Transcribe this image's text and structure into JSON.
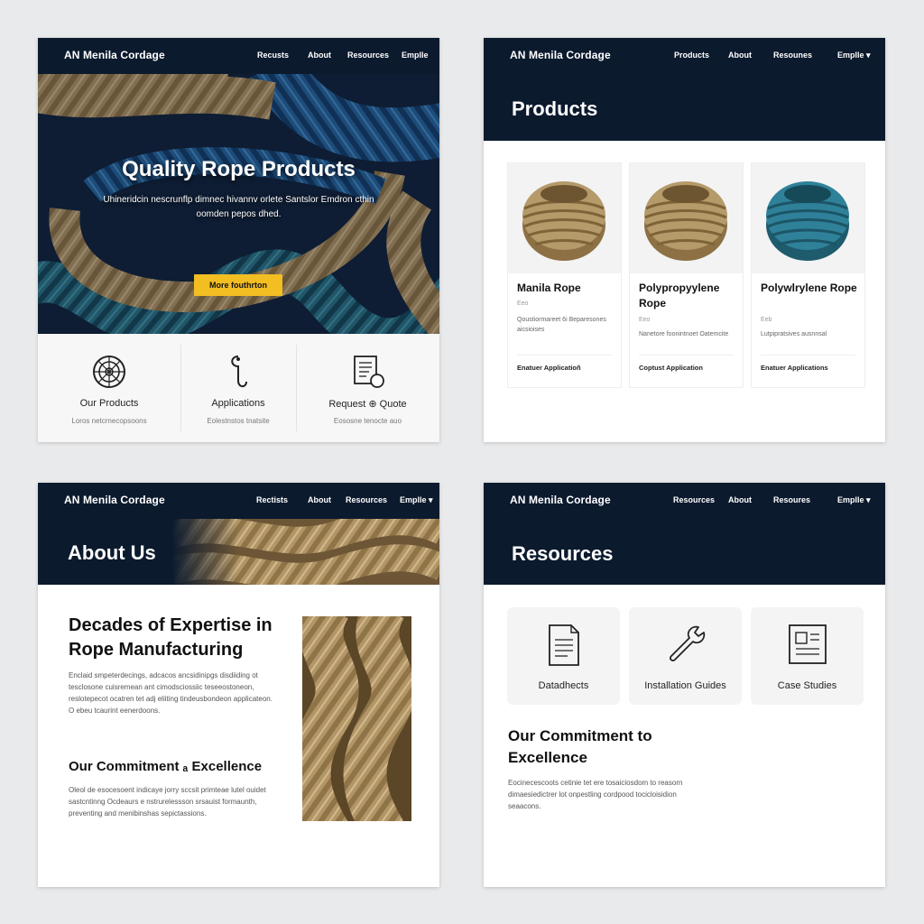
{
  "colors": {
    "nav": "#0c1a2e",
    "accent": "#f2be22",
    "tan": "#b69a6c",
    "blue": "#2a78b0",
    "teal": "#2e7e95"
  },
  "home": {
    "brand": "AN Menila Cordage",
    "nav": [
      "Recusts",
      "About",
      "Resources",
      "Emplle"
    ],
    "hero_title": "Quality Rope Products",
    "hero_text": "Uhineridcin nescrunflp dimnec hivannv orlete Santslor Emdron cthin oomden pepos dhed.",
    "cta": "More fouthrton",
    "features": [
      {
        "icon": "rope-coil-icon",
        "title": "Our Products",
        "desc": "Loros netcrnecopsoons"
      },
      {
        "icon": "hook-icon",
        "title": "Applications",
        "desc": "Eolestnstos tnatsite"
      },
      {
        "icon": "document-icon",
        "title": "Request ⊕ Quote",
        "desc": "Eososne tenocte auo"
      }
    ]
  },
  "products": {
    "brand": "AN Menila Cordage",
    "nav": [
      "Products",
      "About",
      "Resounes",
      "Emplle ▾"
    ],
    "title": "Products",
    "items": [
      {
        "name": "Manila Rope",
        "sub": "Eeo",
        "desc": "Qoustiormareet 6i Beparesones aicsioises",
        "link": "Enatuer Applicatioñ",
        "color": "tan"
      },
      {
        "name": "Polypropyylene Rope",
        "sub": "Eeo",
        "desc": "Nanetore foonintnoet Oatemcite",
        "link": "Coptust Application",
        "color": "tan"
      },
      {
        "name": "Polywlrylene Rope",
        "sub": "Eeb",
        "desc": "Lutpipratsives ausnnsal",
        "link": "Enatuer Applications",
        "color": "teal"
      }
    ]
  },
  "about": {
    "brand": "AN Menila Cordage",
    "nav": [
      "Rectists",
      "About",
      "Resources",
      "Emplle ▾"
    ],
    "title": "About Us",
    "heading": "Decades of Expertise in Rope Manufacturing",
    "text1": "Enclaid smpeterdecings, adcacos ancsidinipgs disdiiding ot tesclosone cuisremean ant cimodsciossiic teseeostoneon, reslotepecot ocatren tet adj eliiting tindeusbondeon applicateon. O ebeu tcaurint eenerdoons.",
    "heading2": "Our Commitment ₐ Excellence",
    "text2": "Oleol de esocesoent indicaye jorry sccsit primteae lutel ouidet sastcntinng Ocdeaurs e nstrurelessson srsauist formaunth, preventing and menibinshas sepictassions."
  },
  "resources": {
    "brand": "AN Menila Cordage",
    "nav": [
      "Resources",
      "About",
      "Resoures",
      "Emplle ▾"
    ],
    "title": "Resources",
    "cards": [
      {
        "icon": "datasheet-icon",
        "title": "Datadhects"
      },
      {
        "icon": "wrench-icon",
        "title": "Installation Guides"
      },
      {
        "icon": "case-study-icon",
        "title": "Case Studies"
      }
    ],
    "heading": "Our Commitment to Excellence",
    "text": "Eocinecescoots cetinie tet ere tosaiciosdom to reasorn dimaesiedictrer lot onpestling cordpood tocicloisidion seaacons."
  }
}
